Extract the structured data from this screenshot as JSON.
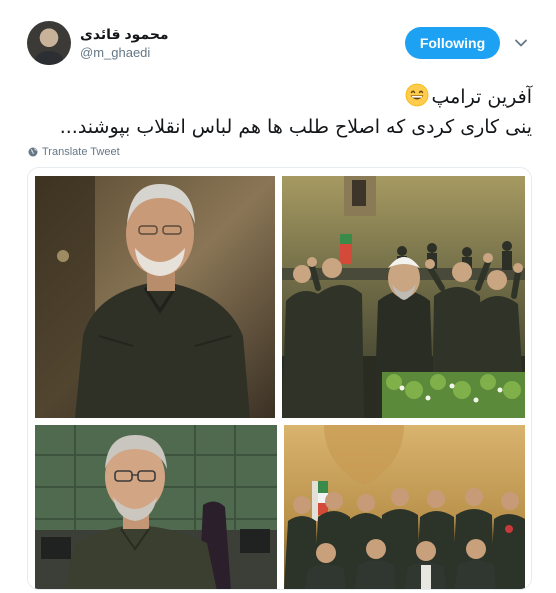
{
  "user": {
    "display_name": "محمود قائدی",
    "handle": "@m_ghaedi",
    "avatar_icon": "avatar-photo"
  },
  "follow_button": {
    "label": "Following",
    "color": "#1da1f2"
  },
  "menu_icon": "chevron-down-icon",
  "tweet": {
    "line1": "آفرین ترامپ",
    "line1_emoji": "grinning-face-emoji",
    "line2": "ینی کاری کردی که اصلاح طلب ها هم لباس انقلاب بپوشند..."
  },
  "translate": {
    "label": "Translate Tweet",
    "icon": "globe-icon"
  },
  "media": {
    "photos": [
      {
        "name": "photo-grey-haired-man-in-uniform"
      },
      {
        "name": "photo-parliament-raised-fists"
      },
      {
        "name": "photo-man-with-glasses-in-parliament"
      },
      {
        "name": "photo-group-in-uniforms"
      }
    ]
  },
  "colors": {
    "text": "#14171a",
    "secondary": "#657786",
    "border": "#e6ecf0",
    "accent": "#1da1f2"
  }
}
